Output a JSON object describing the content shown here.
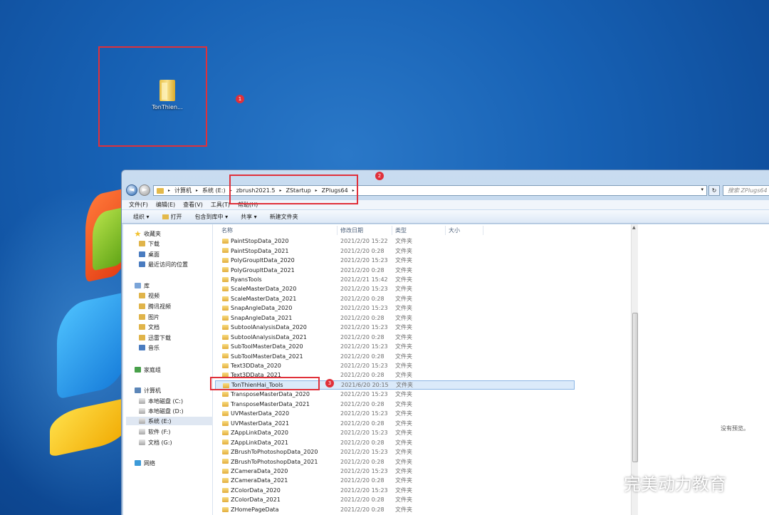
{
  "desktop": {
    "icon_label": "TonThien..."
  },
  "callouts": {
    "badge1": "1",
    "badge2": "2",
    "badge3": "3"
  },
  "address": {
    "crumbs": [
      "计算机",
      "系统 (E:)",
      "zbrush2021.5",
      "ZStartup",
      "ZPlugs64"
    ],
    "search_placeholder": "搜索 ZPlugs64"
  },
  "menubar": [
    "文件(F)",
    "编辑(E)",
    "查看(V)",
    "工具(T)",
    "帮助(H)"
  ],
  "toolbar": {
    "organize": "组织 ▾",
    "open": "打开",
    "include_library": "包含到库中 ▾",
    "share": "共享 ▾",
    "new_folder": "新建文件夹"
  },
  "navpane": {
    "favorites": "收藏夹",
    "fav_items": [
      "下载",
      "桌面",
      "最近访问的位置"
    ],
    "library": "库",
    "lib_items": [
      "视频",
      "腾讯视频",
      "图片",
      "文档",
      "迅雷下载",
      "音乐"
    ],
    "homegroup": "家庭组",
    "computer": "计算机",
    "drives": [
      "本地磁盘 (C:)",
      "本地磁盘 (D:)",
      "系统 (E:)",
      "软件 (F:)",
      "文档 (G:)"
    ],
    "network": "网络"
  },
  "columns": {
    "name": "名称",
    "date": "修改日期",
    "type": "类型",
    "size": "大小"
  },
  "files": [
    {
      "name": "PaintStopData_2020",
      "date": "2021/2/20 15:22",
      "type": "文件夹"
    },
    {
      "name": "PaintStopData_2021",
      "date": "2021/2/20 0:28",
      "type": "文件夹"
    },
    {
      "name": "PolyGroupItData_2020",
      "date": "2021/2/20 15:23",
      "type": "文件夹"
    },
    {
      "name": "PolyGroupItData_2021",
      "date": "2021/2/20 0:28",
      "type": "文件夹"
    },
    {
      "name": "RyansTools",
      "date": "2021/2/21 15:42",
      "type": "文件夹"
    },
    {
      "name": "ScaleMasterData_2020",
      "date": "2021/2/20 15:23",
      "type": "文件夹"
    },
    {
      "name": "ScaleMasterData_2021",
      "date": "2021/2/20 0:28",
      "type": "文件夹"
    },
    {
      "name": "SnapAngleData_2020",
      "date": "2021/2/20 15:23",
      "type": "文件夹"
    },
    {
      "name": "SnapAngleData_2021",
      "date": "2021/2/20 0:28",
      "type": "文件夹"
    },
    {
      "name": "SubtoolAnalysisData_2020",
      "date": "2021/2/20 15:23",
      "type": "文件夹"
    },
    {
      "name": "SubtoolAnalysisData_2021",
      "date": "2021/2/20 0:28",
      "type": "文件夹"
    },
    {
      "name": "SubToolMasterData_2020",
      "date": "2021/2/20 15:23",
      "type": "文件夹"
    },
    {
      "name": "SubToolMasterData_2021",
      "date": "2021/2/20 0:28",
      "type": "文件夹"
    },
    {
      "name": "Text3DData_2020",
      "date": "2021/2/20 15:23",
      "type": "文件夹"
    },
    {
      "name": "Text3DData_2021",
      "date": "2021/2/20 0:28",
      "type": "文件夹"
    },
    {
      "name": "TonThienHai_Tools",
      "date": "2021/6/20 20:15",
      "type": "文件夹",
      "selected": true
    },
    {
      "name": "TransposeMasterData_2020",
      "date": "2021/2/20 15:23",
      "type": "文件夹"
    },
    {
      "name": "TransposeMasterData_2021",
      "date": "2021/2/20 0:28",
      "type": "文件夹"
    },
    {
      "name": "UVMasterData_2020",
      "date": "2021/2/20 15:23",
      "type": "文件夹"
    },
    {
      "name": "UVMasterData_2021",
      "date": "2021/2/20 0:28",
      "type": "文件夹"
    },
    {
      "name": "ZAppLinkData_2020",
      "date": "2021/2/20 15:23",
      "type": "文件夹"
    },
    {
      "name": "ZAppLinkData_2021",
      "date": "2021/2/20 0:28",
      "type": "文件夹"
    },
    {
      "name": "ZBrushToPhotoshopData_2020",
      "date": "2021/2/20 15:23",
      "type": "文件夹"
    },
    {
      "name": "ZBrushToPhotoshopData_2021",
      "date": "2021/2/20 0:28",
      "type": "文件夹"
    },
    {
      "name": "ZCameraData_2020",
      "date": "2021/2/20 15:23",
      "type": "文件夹"
    },
    {
      "name": "ZCameraData_2021",
      "date": "2021/2/20 0:28",
      "type": "文件夹"
    },
    {
      "name": "ZColorData_2020",
      "date": "2021/2/20 15:23",
      "type": "文件夹"
    },
    {
      "name": "ZColorData_2021",
      "date": "2021/2/20 0:28",
      "type": "文件夹"
    },
    {
      "name": "ZHomePageData",
      "date": "2021/2/20 0:28",
      "type": "文件夹"
    }
  ],
  "preview": {
    "message": "没有预览。"
  },
  "watermark": "完美动力教育",
  "colors": {
    "callout": "#e0303a",
    "selection": "#dbeafa"
  }
}
